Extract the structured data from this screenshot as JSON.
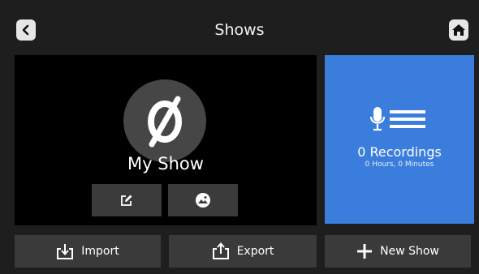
{
  "header": {
    "title": "Shows",
    "back_icon": "chevron-left-icon",
    "home_icon": "home-icon"
  },
  "show": {
    "name": "My Show",
    "avatar_glyph": "Ø",
    "edit_icon": "edit-icon",
    "image_icon": "image-icon"
  },
  "recordings": {
    "count_label": "0 Recordings",
    "duration_label": "0 Hours, 0 Minutes",
    "icon": "microphone-list-icon",
    "color": "#3a7ddc"
  },
  "toolbar": {
    "import_label": "Import",
    "export_label": "Export",
    "new_show_label": "New Show"
  }
}
